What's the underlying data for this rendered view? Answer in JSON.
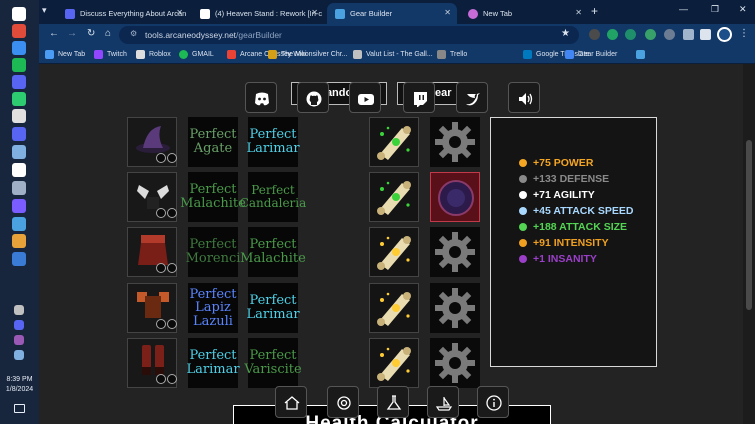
{
  "browser": {
    "tabs": [
      {
        "label": "Discuss Everything About Arcan",
        "active": false
      },
      {
        "label": "(4) Heaven Stand : Rework [In-c",
        "active": false
      },
      {
        "label": "Gear Builder",
        "active": true
      },
      {
        "label": "New Tab",
        "active": false
      }
    ],
    "url_domain": "tools.arcaneodyssey.net",
    "url_path": "/gearBuilder",
    "bookmarks": [
      "New Tab",
      "Twitch",
      "Roblox",
      "GMAIL",
      "Arcane Odyssey Wiki",
      "The Moonsilver Chr...",
      "Valut List - The Gall...",
      "Trello",
      "Google Translate",
      "Gear Builder"
    ]
  },
  "taskbar": {
    "time": "8:39 PM",
    "date": "1/8/2024"
  },
  "page": {
    "top_buttons": [
      {
        "label": "Random"
      },
      {
        "label": "Clear"
      }
    ],
    "social_icons": [
      "discord-icon",
      "github-icon",
      "youtube-icon",
      "twitch-icon",
      "twitter-icon",
      "volume-icon"
    ],
    "gear_rows": [
      {
        "armor": "Hat",
        "gem1": "Perfect Agate",
        "gem2": "Perfect Larimar",
        "enchant": "green",
        "modifier": "empty"
      },
      {
        "armor": "Amulet",
        "gem1": "Perfect Malachite",
        "gem2": "Perfect Candaleria",
        "enchant": "green",
        "modifier": "orb"
      },
      {
        "armor": "Cape",
        "gem1": "Perfect Morenci",
        "gem2": "Perfect Malachite",
        "enchant": "gold",
        "modifier": "empty"
      },
      {
        "armor": "Chest",
        "gem1": "Perfect Lapiz Lazuli",
        "gem2": "Perfect Larimar",
        "enchant": "gold",
        "modifier": "empty"
      },
      {
        "armor": "Boots",
        "gem1": "Perfect Larimar",
        "gem2": "Perfect Variscite",
        "enchant": "gold",
        "modifier": "empty"
      }
    ],
    "stats": [
      {
        "text": "+75 POWER",
        "color": "#f5a623"
      },
      {
        "text": "+133 DEFENSE",
        "color": "#8a8a8a"
      },
      {
        "text": "+71 AGILITY",
        "color": "#ffffff"
      },
      {
        "text": "+45 ATTACK SPEED",
        "color": "#a9d8ff"
      },
      {
        "text": "+188 ATTACK SIZE",
        "color": "#53d453"
      },
      {
        "text": "+91 INTENSITY",
        "color": "#f0a020"
      },
      {
        "text": "+1 INSANITY",
        "color": "#9b3fc8"
      }
    ],
    "health_calculator_label": "Health Calculator",
    "bottom_nav_icons": [
      "home-icon",
      "settings-icon",
      "flask-icon",
      "ship-icon",
      "info-icon"
    ]
  }
}
